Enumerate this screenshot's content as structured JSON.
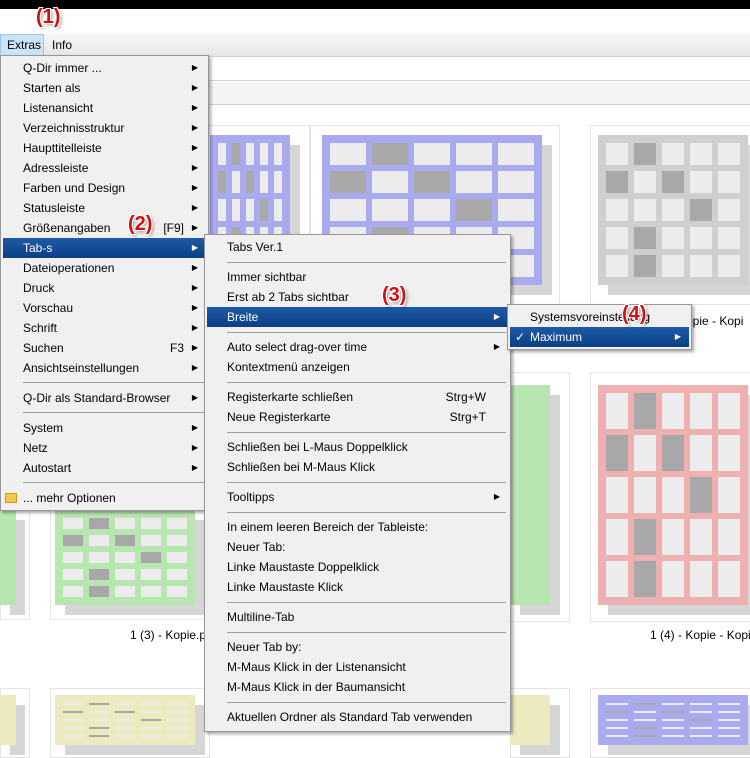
{
  "menubar": {
    "extras": "Extras",
    "info": "Info"
  },
  "callouts": {
    "c1": "(1)",
    "c2": "(2)",
    "c3": "(3)",
    "c4": "(4)"
  },
  "files": {
    "label_r1_4": "kopie - Kopi",
    "label_r2_3": "1 (3) - Kopie.p",
    "label_r2_4": "1 (4) - Kopie - Kopi"
  },
  "extras_menu": {
    "items": [
      {
        "label": "Q-Dir immer ...",
        "arrow": "▶"
      },
      {
        "label": "Starten als",
        "arrow": "▶"
      },
      {
        "label": "Listenansicht",
        "arrow": "▶"
      },
      {
        "label": "Verzeichnisstruktur",
        "arrow": "▶"
      },
      {
        "label": "Haupttitelleiste",
        "arrow": "▶"
      },
      {
        "label": "Adressleiste",
        "arrow": "▶"
      },
      {
        "label": "Farben und Design",
        "arrow": "▶"
      },
      {
        "label": "Statusleiste",
        "arrow": "▶"
      },
      {
        "label": "Größenangaben",
        "shortcut": "[F9]",
        "arrow": "▶"
      },
      {
        "label": "Tab-s",
        "arrow": "▶"
      },
      {
        "label": "Dateioperationen",
        "arrow": "▶"
      },
      {
        "label": "Druck",
        "arrow": "▶"
      },
      {
        "label": "Vorschau",
        "arrow": "▶"
      },
      {
        "label": "Schrift",
        "arrow": "▶"
      },
      {
        "label": "Suchen",
        "shortcut": "F3",
        "arrow": "▶"
      },
      {
        "label": "Ansichtseinstellungen",
        "arrow": "▶"
      },
      {
        "label": "Q-Dir als Standard-Browser",
        "arrow": "▶"
      },
      {
        "label": "System",
        "arrow": "▶"
      },
      {
        "label": "Netz",
        "arrow": "▶"
      },
      {
        "label": "Autostart",
        "arrow": "▶"
      },
      {
        "label": "... mehr Optionen"
      }
    ]
  },
  "tabs_menu": {
    "items": [
      {
        "label": "Tabs Ver.1"
      },
      {
        "label": "Immer sichtbar"
      },
      {
        "label": "Erst ab 2 Tabs sichtbar"
      },
      {
        "label": "Breite",
        "arrow": "▶"
      },
      {
        "label": "Auto select drag-over time",
        "arrow": "▶"
      },
      {
        "label": "Kontextmenü anzeigen"
      },
      {
        "label": "Registerkarte schließen",
        "shortcut": "Strg+W"
      },
      {
        "label": "Neue Registerkarte",
        "shortcut": "Strg+T"
      },
      {
        "label": "Schließen bei L-Maus Doppelklick"
      },
      {
        "label": "Schließen bei M-Maus Klick"
      },
      {
        "label": "Tooltipps",
        "arrow": "▶"
      },
      {
        "label": "In einem leeren Bereich der Tableiste:"
      },
      {
        "label": "Neuer Tab:"
      },
      {
        "label": "Linke Maustaste Doppelklick"
      },
      {
        "label": "Linke Maustaste Klick"
      },
      {
        "label": "Multiline-Tab"
      },
      {
        "label": "Neuer Tab by:"
      },
      {
        "label": "M-Maus Klick in der Listenansicht"
      },
      {
        "label": "M-Maus Klick in der Baumansicht"
      },
      {
        "label": "Aktuellen Ordner als Standard Tab verwenden"
      }
    ]
  },
  "breite_menu": {
    "items": [
      {
        "label": "Systemsvoreinstellung"
      },
      {
        "label": "Maximum",
        "check": "✓",
        "arrow": "▶"
      }
    ]
  },
  "colors": {
    "highlight": "#0b3f86",
    "callout": "#d01010",
    "blue_thumb": "#aaaaee",
    "green_thumb": "#b8e6b0",
    "red_thumb": "#eeb0b0",
    "yellow_thumb": "#ecebc0",
    "gray_thumb": "#cfcfcf"
  }
}
